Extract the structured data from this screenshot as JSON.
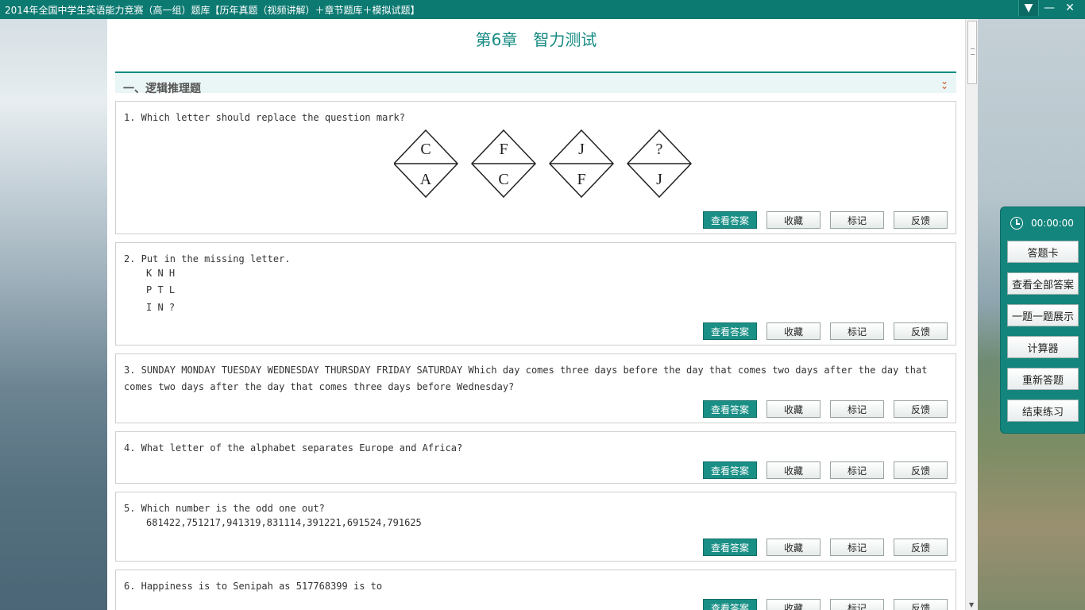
{
  "window": {
    "title": "2014年全国中学生英语能力竞赛（高一组）题库【历年真题（视频讲解）＋章节题库＋模拟试题】",
    "controls": [
      "▼",
      "—",
      "✕"
    ]
  },
  "chapter_title": "第6章　智力测试",
  "section": {
    "title": "一、逻辑推理题",
    "collapse_icon": "double-chevron-down-icon",
    "accent_color": "#148a82"
  },
  "buttons": {
    "view_answer": "查看答案",
    "favorite": "收藏",
    "mark": "标记",
    "feedback": "反馈"
  },
  "questions": [
    {
      "text": "1. Which letter should replace the question mark?",
      "diamonds": [
        {
          "top": "C",
          "bottom": "A"
        },
        {
          "top": "F",
          "bottom": "C"
        },
        {
          "top": "J",
          "bottom": "F"
        },
        {
          "top": "?",
          "bottom": "J"
        }
      ]
    },
    {
      "text": "2. Put in the missing letter.",
      "lines": [
        "K N H",
        "P T L",
        "I N ?"
      ]
    },
    {
      "text": "3. SUNDAY MONDAY TUESDAY WEDNESDAY THURSDAY FRIDAY SATURDAY Which day comes three days before the day that comes two days after the day that comes two days after the day that comes three days before Wednesday?"
    },
    {
      "text": "4. What letter of the alphabet separates Europe and Africa?"
    },
    {
      "text": "5. Which number is the odd one out?",
      "lines": [
        "681422,751217,941319,831114,391221,691524,791625"
      ]
    },
    {
      "text": "6. Happiness is to Senipah as 517768399 is to"
    }
  ],
  "panel": {
    "timer": "00:00:00",
    "items": [
      "答题卡",
      "查看全部答案",
      "一题一题展示",
      "计算器",
      "重新答题",
      "结束练习"
    ]
  }
}
